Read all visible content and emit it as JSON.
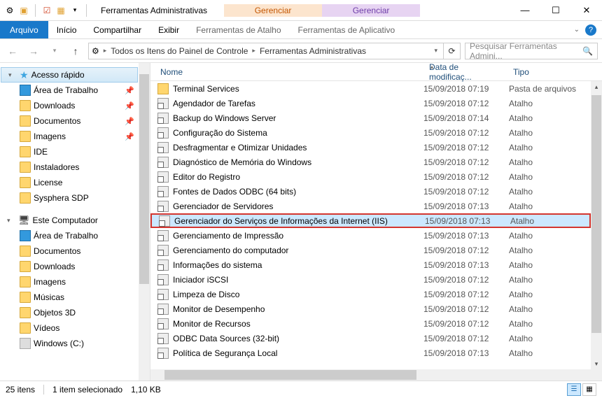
{
  "titlebar": {
    "title": "Ferramentas Administrativas"
  },
  "contextTabs": [
    {
      "group": "Gerenciar",
      "sub": "Ferramentas de Atalho",
      "color": "orange"
    },
    {
      "group": "Gerenciar",
      "sub": "Ferramentas de Aplicativo",
      "color": "green"
    }
  ],
  "ribbon": {
    "file": "Arquivo",
    "tabs": [
      "Início",
      "Compartilhar",
      "Exibir"
    ],
    "subs": [
      "Ferramentas de Atalho",
      "Ferramentas de Aplicativo"
    ]
  },
  "breadcrumb": {
    "seg1": "Todos os Itens do Painel de Controle",
    "seg2": "Ferramentas Administrativas"
  },
  "search": {
    "placeholder": "Pesquisar Ferramentas Admini..."
  },
  "columns": {
    "name": "Nome",
    "date": "Data de modificaç...",
    "type": "Tipo"
  },
  "sidebar": {
    "quickAccess": "Acesso rápido",
    "quickItems": [
      {
        "label": "Área de Trabalho",
        "icon": "monitor",
        "pin": true
      },
      {
        "label": "Downloads",
        "icon": "folder",
        "pin": true
      },
      {
        "label": "Documentos",
        "icon": "folder",
        "pin": true
      },
      {
        "label": "Imagens",
        "icon": "folder",
        "pin": true
      },
      {
        "label": "IDE",
        "icon": "folder",
        "pin": false
      },
      {
        "label": "Instaladores",
        "icon": "folder",
        "pin": false
      },
      {
        "label": "License",
        "icon": "folder",
        "pin": false
      },
      {
        "label": "Sysphera SDP",
        "icon": "folder",
        "pin": false
      }
    ],
    "thisPC": "Este Computador",
    "pcItems": [
      {
        "label": "Área de Trabalho",
        "icon": "monitor"
      },
      {
        "label": "Documentos",
        "icon": "folder"
      },
      {
        "label": "Downloads",
        "icon": "folder"
      },
      {
        "label": "Imagens",
        "icon": "folder"
      },
      {
        "label": "Músicas",
        "icon": "folder"
      },
      {
        "label": "Objetos 3D",
        "icon": "folder"
      },
      {
        "label": "Vídeos",
        "icon": "folder"
      },
      {
        "label": "Windows (C:)",
        "icon": "drive"
      }
    ]
  },
  "files": [
    {
      "name": "Terminal Services",
      "date": "15/09/2018 07:19",
      "type": "Pasta de arquivos",
      "icon": "folder"
    },
    {
      "name": "Agendador de Tarefas",
      "date": "15/09/2018 07:12",
      "type": "Atalho",
      "icon": "shortcut"
    },
    {
      "name": "Backup do Windows Server",
      "date": "15/09/2018 07:14",
      "type": "Atalho",
      "icon": "shortcut"
    },
    {
      "name": "Configuração do Sistema",
      "date": "15/09/2018 07:12",
      "type": "Atalho",
      "icon": "shortcut"
    },
    {
      "name": "Desfragmentar e Otimizar Unidades",
      "date": "15/09/2018 07:12",
      "type": "Atalho",
      "icon": "shortcut"
    },
    {
      "name": "Diagnóstico de Memória do Windows",
      "date": "15/09/2018 07:12",
      "type": "Atalho",
      "icon": "shortcut"
    },
    {
      "name": "Editor do Registro",
      "date": "15/09/2018 07:12",
      "type": "Atalho",
      "icon": "shortcut"
    },
    {
      "name": "Fontes de Dados ODBC (64 bits)",
      "date": "15/09/2018 07:12",
      "type": "Atalho",
      "icon": "shortcut"
    },
    {
      "name": "Gerenciador de Servidores",
      "date": "15/09/2018 07:13",
      "type": "Atalho",
      "icon": "shortcut"
    },
    {
      "name": "Gerenciador do Serviços de Informações da Internet (IIS)",
      "date": "15/09/2018 07:13",
      "type": "Atalho",
      "icon": "shortcut",
      "selected": true,
      "highlight": true
    },
    {
      "name": "Gerenciamento de Impressão",
      "date": "15/09/2018 07:13",
      "type": "Atalho",
      "icon": "shortcut"
    },
    {
      "name": "Gerenciamento do computador",
      "date": "15/09/2018 07:12",
      "type": "Atalho",
      "icon": "shortcut"
    },
    {
      "name": "Informações do sistema",
      "date": "15/09/2018 07:13",
      "type": "Atalho",
      "icon": "shortcut"
    },
    {
      "name": "Iniciador iSCSI",
      "date": "15/09/2018 07:12",
      "type": "Atalho",
      "icon": "shortcut"
    },
    {
      "name": "Limpeza de Disco",
      "date": "15/09/2018 07:12",
      "type": "Atalho",
      "icon": "shortcut"
    },
    {
      "name": "Monitor de Desempenho",
      "date": "15/09/2018 07:12",
      "type": "Atalho",
      "icon": "shortcut"
    },
    {
      "name": "Monitor de Recursos",
      "date": "15/09/2018 07:12",
      "type": "Atalho",
      "icon": "shortcut"
    },
    {
      "name": "ODBC Data Sources (32-bit)",
      "date": "15/09/2018 07:12",
      "type": "Atalho",
      "icon": "shortcut"
    },
    {
      "name": "Política de Segurança Local",
      "date": "15/09/2018 07:13",
      "type": "Atalho",
      "icon": "shortcut"
    }
  ],
  "status": {
    "count": "25 itens",
    "selection": "1 item selecionado",
    "size": "1,10 KB"
  }
}
